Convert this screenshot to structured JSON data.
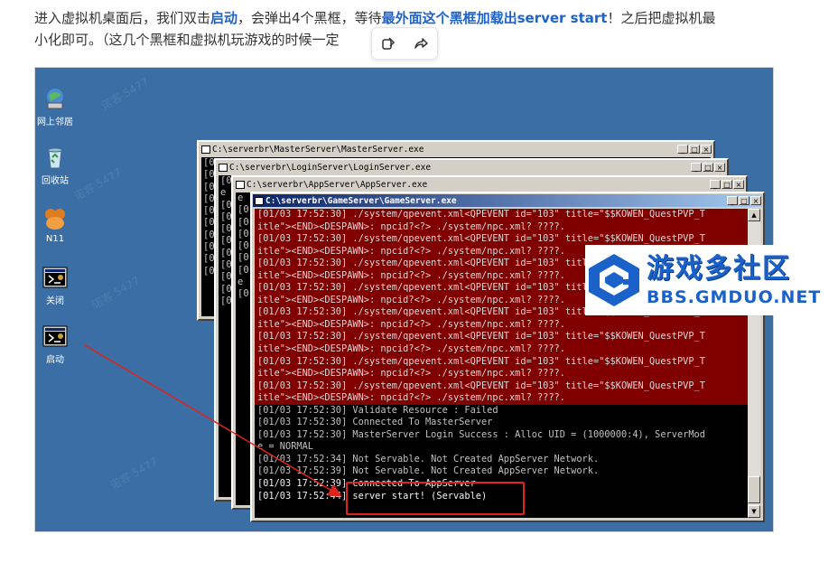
{
  "article": {
    "text_before": "进入虚拟机桌面后，我们双击",
    "bold_1": "启动",
    "text_mid": "，会弹出4个黑框，等待",
    "bold_2": "最外面这个黑框加载出server start",
    "text_after": "！之后把虚拟机最",
    "line2": "小化即可。（这几个黑框和虚拟机玩游戏的时候一定"
  },
  "toolbar": {
    "icons": [
      "paint-icon",
      "share-icon"
    ]
  },
  "desktop": {
    "icons": [
      {
        "name": "network-icon",
        "label": "网上邻居"
      },
      {
        "name": "recycle-bin-icon",
        "label": "回收站"
      },
      {
        "name": "n11-icon",
        "label": "N11"
      },
      {
        "name": "close-program-icon",
        "label": "关闭"
      },
      {
        "name": "start-program-icon",
        "label": "启动"
      }
    ],
    "watermark": "诺客 5477"
  },
  "windows": {
    "master": {
      "title": "C:\\serverbr\\MasterServer\\MasterServer.exe",
      "lines": [
        "[0",
        "[0",
        "[0",
        "[0",
        "[0",
        "[0",
        "[0",
        "[0",
        "[0",
        "[0"
      ]
    },
    "login": {
      "title": "C:\\serverbr\\LoginServer\\LoginServer.exe",
      "lines": [
        "[0",
        "e",
        "[0",
        "[0",
        "[0",
        "[0",
        "[0",
        "[0",
        "[0",
        "[0",
        "[0"
      ]
    },
    "app": {
      "title": "C:\\serverbr\\AppServer\\AppServer.exe",
      "lines": [
        "e",
        "[0",
        "[0",
        "[0",
        "[0",
        "[0",
        "[0",
        "e",
        "[0"
      ]
    },
    "game": {
      "title": "C:\\serverbr\\GameServer\\GameServer.exe",
      "buttons": [
        "_",
        "□",
        "×"
      ],
      "lines": [
        {
          "t": "[01/03 17:52:30] ./system/qpevent.xml<QPEVENT id=\"103\" title=\"$$KOWEN_QuestPVP_T",
          "s": "red"
        },
        {
          "t": "itle\"><END><DESPAWN>: npcid?<?> ./system/npc.xml? ????.",
          "s": "red"
        },
        {
          "t": "[01/03 17:52:30] ./system/qpevent.xml<QPEVENT id=\"103\" title=\"$$KOWEN_QuestPVP_T",
          "s": "red"
        },
        {
          "t": "itle\"><END><DESPAWN>: npcid?<?> ./system/npc.xml? ????.",
          "s": "red"
        },
        {
          "t": "[01/03 17:52:30] ./system/qpevent.xml<QPEVENT id=\"103\" title=\"$$KOWEN_QuestPVP_T",
          "s": "red"
        },
        {
          "t": "itle\"><END><DESPAWN>: npcid?<?> ./system/npc.xml? ????.",
          "s": "red"
        },
        {
          "t": "[01/03 17:52:30] ./system/qpevent.xml<QPEVENT id=\"103\" title=\"$$KOWEN_QuestPVP_T",
          "s": "red"
        },
        {
          "t": "itle\"><END><DESPAWN>: npcid?<?> ./system/npc.xml? ????.",
          "s": "red"
        },
        {
          "t": "[01/03 17:52:30] ./system/qpevent.xml<QPEVENT id=\"103\" title=\"$$KOWEN_QuestPVP_T",
          "s": "red"
        },
        {
          "t": "itle\"><END><DESPAWN>: npcid?<?> ./system/npc.xml? ????.",
          "s": "red"
        },
        {
          "t": "[01/03 17:52:30] ./system/qpevent.xml<QPEVENT id=\"103\" title=\"$$KOWEN_QuestPVP_T",
          "s": "red"
        },
        {
          "t": "itle\"><END><DESPAWN>: npcid?<?> ./system/npc.xml? ????.",
          "s": "red"
        },
        {
          "t": "[01/03 17:52:30] ./system/qpevent.xml<QPEVENT id=\"103\" title=\"$$KOWEN_QuestPVP_T",
          "s": "red"
        },
        {
          "t": "itle\"><END><DESPAWN>: npcid?<?> ./system/npc.xml? ????.",
          "s": "red"
        },
        {
          "t": "[01/03 17:52:30] ./system/qpevent.xml<QPEVENT id=\"103\" title=\"$$KOWEN_QuestPVP_T",
          "s": "red"
        },
        {
          "t": "itle\"><END><DESPAWN>: npcid?<?> ./system/npc.xml? ????.",
          "s": "red"
        },
        {
          "t": "[01/03 17:52:30] Validate Resource : Failed",
          "s": ""
        },
        {
          "t": "[01/03 17:52:30] Connected To MasterServer",
          "s": ""
        },
        {
          "t": "[01/03 17:52:30] MasterServer Login Success : Alloc UID = (1000000:4), ServerMod",
          "s": ""
        },
        {
          "t": "e = NORMAL",
          "s": ""
        },
        {
          "t": "[01/03 17:52:34] Not Servable. Not Created AppServer Network.",
          "s": ""
        },
        {
          "t": "[01/03 17:52:39] Not Servable. Not Created AppServer Network.",
          "s": ""
        },
        {
          "t": "[01/03 17:52:39] Connected To AppServer",
          "s": "hl"
        },
        {
          "t": "[01/03 17:52:44] server start! (Servable)",
          "s": "hl"
        }
      ]
    }
  },
  "logo": {
    "cn": "游戏多社区",
    "en": "BBS.GMDUO.NET"
  },
  "colors": {
    "accent": "#1f63c9",
    "desktop": "#3a6ea5",
    "annotation": "#e0241b"
  }
}
